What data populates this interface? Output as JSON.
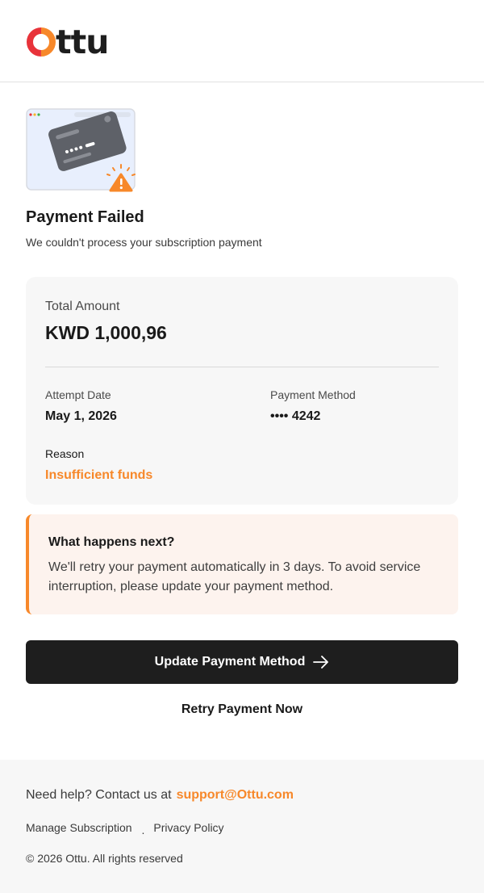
{
  "brand": {
    "name": "ttu",
    "accent": "#f7882a",
    "accent_red": "#e8333a"
  },
  "status": {
    "title": "Payment Failed",
    "subtitle": "We couldn't process your subscription payment"
  },
  "details": {
    "amount_label": "Total Amount",
    "amount": "KWD 1,000,96",
    "attempt_date_label": "Attempt Date",
    "attempt_date": "May 1, 2026",
    "payment_method_label": "Payment Method",
    "payment_method": "•••• 4242",
    "reason_label": "Reason",
    "reason": "Insufficient funds"
  },
  "notice": {
    "title": "What happens next?",
    "body": "We'll retry your payment automatically in 3 days. To avoid service interruption, please update your payment method."
  },
  "actions": {
    "primary": "Update Payment Method",
    "secondary": "Retry Payment Now"
  },
  "footer": {
    "help_text": "Need help? Contact us at",
    "support_email": "support@Ottu.com",
    "link_manage": "Manage Subscription",
    "separator": ".",
    "link_privacy": "Privacy Policy",
    "copyright": "© 2026 Ottu. All rights reserved"
  },
  "icons": [
    "ottu-logo-icon",
    "failed-card-illustration",
    "warning-icon",
    "arrow-right-icon"
  ]
}
